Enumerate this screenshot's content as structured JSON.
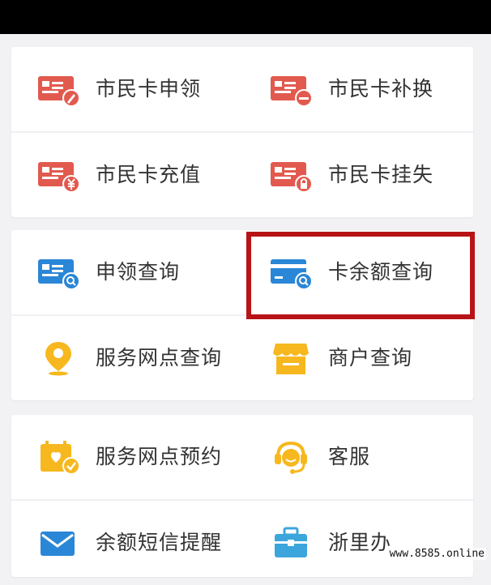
{
  "colors": {
    "red": "#e25a4f",
    "blue": "#2a86d6",
    "yellow": "#f6b81e",
    "highlight": "#b81417"
  },
  "groups": [
    {
      "rows": [
        [
          {
            "label": "市民卡申领",
            "icon": "citizen-card-apply-icon"
          },
          {
            "label": "市民卡补换",
            "icon": "citizen-card-replace-icon"
          }
        ],
        [
          {
            "label": "市民卡充值",
            "icon": "citizen-card-recharge-icon"
          },
          {
            "label": "市民卡挂失",
            "icon": "citizen-card-report-loss-icon"
          }
        ]
      ]
    },
    {
      "rows": [
        [
          {
            "label": "申领查询",
            "icon": "application-query-icon"
          },
          {
            "label": "卡余额查询",
            "icon": "card-balance-query-icon",
            "highlighted": true
          }
        ],
        [
          {
            "label": "服务网点查询",
            "icon": "location-pin-icon"
          },
          {
            "label": "商户查询",
            "icon": "merchant-store-icon"
          }
        ]
      ]
    },
    {
      "rows": [
        [
          {
            "label": "服务网点预约",
            "icon": "calendar-appointment-icon"
          },
          {
            "label": "客服",
            "icon": "customer-service-headset-icon"
          }
        ],
        [
          {
            "label": "余额短信提醒",
            "icon": "envelope-icon"
          },
          {
            "label": "浙里办",
            "icon": "briefcase-icon"
          }
        ]
      ]
    }
  ],
  "watermark": "www.8585.online"
}
